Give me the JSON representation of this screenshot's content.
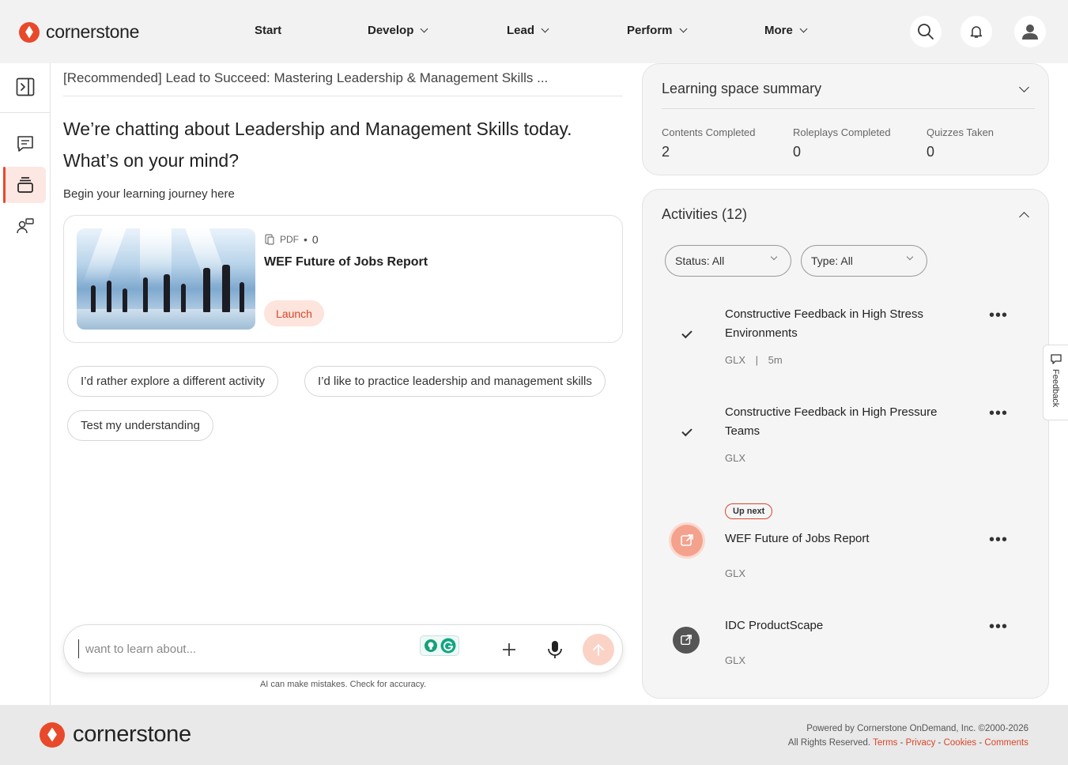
{
  "header": {
    "brand": "cornerstone",
    "nav": [
      {
        "label": "Start"
      },
      {
        "label": "Develop"
      },
      {
        "label": "Lead"
      },
      {
        "label": "Perform"
      },
      {
        "label": "More"
      }
    ]
  },
  "main": {
    "breadcrumb": "[Recommended] Lead to Succeed: Mastering Leadership & Management Skills ...",
    "greeting_line1": "We’re chatting about Leadership and Management Skills today.",
    "greeting_line2": "What’s on your mind?",
    "begin_text": "Begin your learning journey here",
    "card": {
      "type": "PDF",
      "count": "0",
      "title": "WEF Future of Jobs Report",
      "launch": "Launch"
    },
    "chips": [
      "I’d rather explore a different activity",
      "I’d like to practice leadership and management skills",
      "Test my understanding"
    ],
    "input_placeholder": "want to learn about...",
    "disclaimer": "AI can make mistakes. Check for accuracy."
  },
  "summary": {
    "title": "Learning space summary",
    "stats": [
      {
        "label": "Contents Completed",
        "value": "2"
      },
      {
        "label": "Roleplays Completed",
        "value": "0"
      },
      {
        "label": "Quizzes Taken",
        "value": "0"
      }
    ]
  },
  "activities": {
    "title": "Activities (12)",
    "filters": {
      "status": "Status: All",
      "type": "Type: All"
    },
    "upnext": "Up next",
    "items": [
      {
        "title": "Constructive Feedback in High Stress Environments",
        "provider": "GLX",
        "duration": "5m",
        "sep": "|",
        "state": "completed"
      },
      {
        "title": "Constructive Feedback in High Pressure Teams",
        "provider": "GLX",
        "state": "completed"
      },
      {
        "title": "WEF Future of Jobs Report",
        "provider": "GLX",
        "state": "up-next"
      },
      {
        "title": "IDC ProductScape",
        "provider": "GLX",
        "state": "not-started"
      }
    ]
  },
  "feedback": "Feedback",
  "footer": {
    "brand": "cornerstone",
    "powered": "Powered by Cornerstone OnDemand, Inc. ©2000-2026",
    "rights": "All Rights Reserved.",
    "links": [
      "Terms",
      "Privacy",
      "Cookies",
      "Comments"
    ],
    "link_sep": " - "
  },
  "colors": {
    "accent": "#e8492b",
    "launch_bg": "#fde4dc",
    "panel_bg": "#f5f5f5"
  }
}
